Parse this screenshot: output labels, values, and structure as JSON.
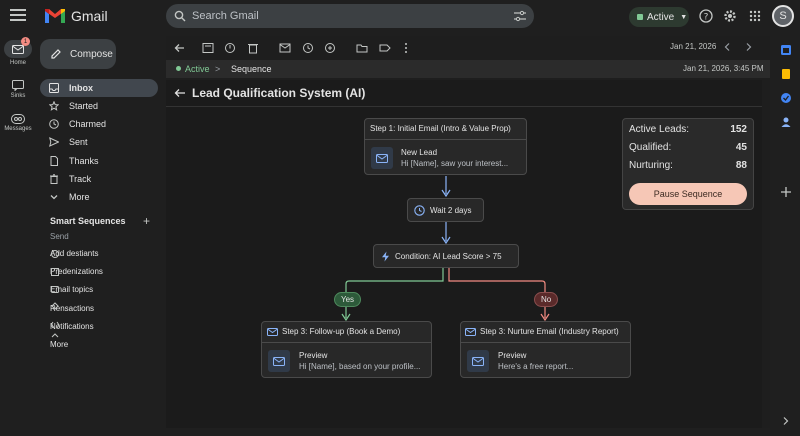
{
  "app": {
    "name": "Gmail"
  },
  "search": {
    "placeholder": "Search Gmail"
  },
  "status": {
    "label": "Active",
    "color": "#81c995"
  },
  "account": {
    "initial": "S"
  },
  "rail": {
    "home": {
      "label": "Home",
      "badge": "1"
    },
    "chats": {
      "label": "Sinks"
    },
    "messages": {
      "label": "Messages"
    }
  },
  "sidebar": {
    "compose_label": "Compose",
    "items": [
      {
        "label": "Inbox",
        "icon": "inbox-icon"
      },
      {
        "label": "Started",
        "icon": "star-icon"
      },
      {
        "label": "Charmed",
        "icon": "clock-icon"
      },
      {
        "label": "Sent",
        "icon": "send-icon"
      },
      {
        "label": "Thanks",
        "icon": "draft-icon"
      },
      {
        "label": "Track",
        "icon": "trash-icon"
      },
      {
        "label": "More",
        "icon": "chevron-down-icon"
      }
    ],
    "smart_heading": "Smart Sequences",
    "smart_items": [
      {
        "label": "Send"
      },
      {
        "label": "Add destiants"
      },
      {
        "label": "Predenizations"
      },
      {
        "label": "Email topics"
      },
      {
        "label": "Rensactions"
      },
      {
        "label": "Notifications"
      },
      {
        "label": "More"
      }
    ]
  },
  "toolbar": {
    "date": "Jan 21, 2026"
  },
  "breadcrumb": {
    "status": "Active",
    "separator": ">",
    "section": "Sequence",
    "date": "Jan 21, 2026, 3:45 PM"
  },
  "page": {
    "title": "Lead Qualification System (AI)"
  },
  "flow": {
    "step1": {
      "title": "Step 1: Initial Email (Intro & Value Prop)",
      "preview_title": "New Lead",
      "preview_body": "Hi [Name], saw your interest..."
    },
    "wait": {
      "label": "Wait 2 days"
    },
    "condition": {
      "label": "Condition: AI Lead Score > 75"
    },
    "yes_label": "Yes",
    "no_label": "No",
    "step3_yes": {
      "title": "Step 3: Follow-up (Book a Demo)",
      "preview_title": "Preview",
      "preview_body": "Hi [Name], based on your profile..."
    },
    "step3_no": {
      "title": "Step 3: Nurture Email (Industry Report)",
      "preview_title": "Preview",
      "preview_body": "Here's a free report..."
    },
    "colors": {
      "yes": "#81c995",
      "no": "#f28b82",
      "line": "#8ab4f8"
    }
  },
  "stats": {
    "active": {
      "label": "Active Leads:",
      "value": "152"
    },
    "qualified": {
      "label": "Qualified:",
      "value": "45"
    },
    "nurturing": {
      "label": "Nurturing:",
      "value": "88"
    },
    "pause_label": "Pause Sequence"
  }
}
